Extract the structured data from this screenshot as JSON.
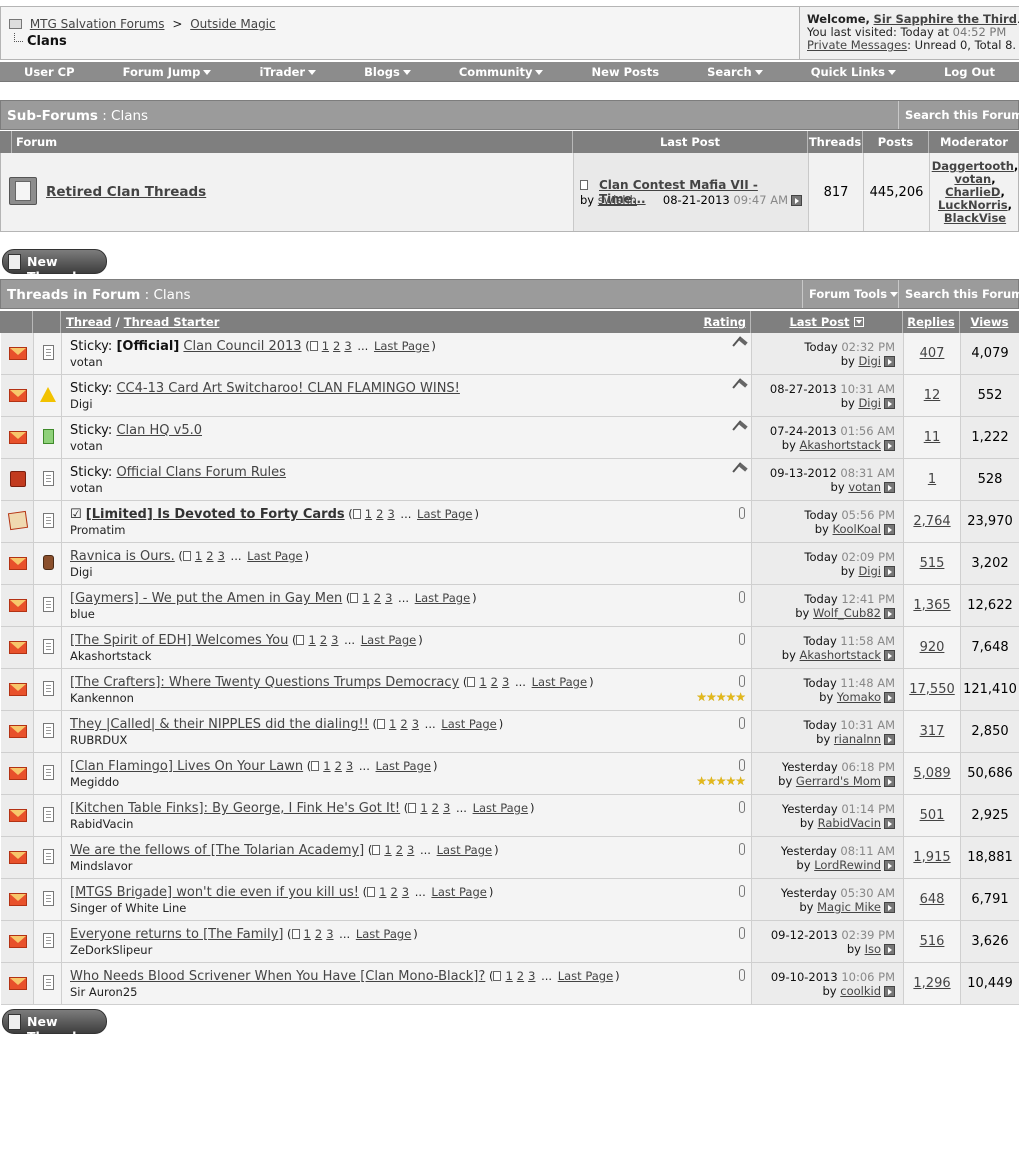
{
  "breadcrumb": {
    "root": "MTG Salvation Forums",
    "separator": ">",
    "parent": "Outside Magic",
    "current": "Clans"
  },
  "welcome": {
    "greeting": "Welcome,",
    "username": "Sir Sapphire the Third",
    "last_visited_label": "You last visited:",
    "last_visited_day": "Today at",
    "last_visited_time": "04:52 PM",
    "pm_link": "Private Messages",
    "pm_status": ": Unread 0, Total 8."
  },
  "navbar": [
    {
      "label": "User CP",
      "dropdown": false
    },
    {
      "label": "Forum Jump",
      "dropdown": true
    },
    {
      "label": "iTrader",
      "dropdown": true
    },
    {
      "label": "Blogs",
      "dropdown": true
    },
    {
      "label": "Community",
      "dropdown": true
    },
    {
      "label": "New Posts",
      "dropdown": false
    },
    {
      "label": "Search",
      "dropdown": true
    },
    {
      "label": "Quick Links",
      "dropdown": true
    },
    {
      "label": "Log Out",
      "dropdown": false
    }
  ],
  "subforums": {
    "header_bold": "Sub-Forums",
    "header_rest": " : Clans",
    "search_tool": "Search this Forum",
    "columns": {
      "forum": "Forum",
      "last_post": "Last Post",
      "threads": "Threads",
      "posts": "Posts",
      "moderator": "Moderator"
    },
    "row": {
      "name": "Retired Clan Threads",
      "last_post_title": "Clan Contest Mafia VII - Time...",
      "by": "by",
      "author": "swishh",
      "date": "08-21-2013",
      "time": "09:47 AM",
      "threads": "817",
      "posts": "445,206",
      "moderators": [
        "Daggertooth",
        "votan",
        "CharlieD",
        "LuckNorris",
        "BlackVise"
      ]
    }
  },
  "new_thread_label": "New Thread",
  "threads_section": {
    "header_bold": "Threads in Forum",
    "header_rest": " : Clans",
    "forum_tools": "Forum Tools",
    "search_tool": "Search this Forum",
    "columns": {
      "thread": "Thread",
      "slash": " / ",
      "starter": "Thread Starter",
      "rating": "Rating",
      "last_post": "Last Post",
      "replies": "Replies",
      "views": "Views"
    }
  },
  "threads": [
    {
      "prefix": "Sticky:",
      "bold": "[Official]",
      "title": "Clan Council 2013",
      "pages": "1 2 3 ... Last Page",
      "starter": "votan",
      "day": "Today",
      "time": "02:32 PM",
      "by": "Digi",
      "replies": "407",
      "views": "4,079",
      "pinned": true,
      "attach": false,
      "stars": ""
    },
    {
      "prefix": "Sticky:",
      "bold": "",
      "title": "CC4-13 Card Art Switcharoo! CLAN FLAMINGO WINS!",
      "pages": "",
      "starter": "Digi",
      "day": "08-27-2013",
      "time": "10:31 AM",
      "by": "Digi",
      "replies": "12",
      "views": "552",
      "pinned": true,
      "attach": false,
      "stars": ""
    },
    {
      "prefix": "Sticky:",
      "bold": "",
      "title": "Clan HQ v5.0",
      "pages": "",
      "starter": "votan",
      "day": "07-24-2013",
      "time": "01:56 AM",
      "by": "Akashortstack",
      "replies": "11",
      "views": "1,222",
      "pinned": true,
      "attach": false,
      "stars": ""
    },
    {
      "prefix": "Sticky:",
      "bold": "",
      "title": "Official Clans Forum Rules",
      "pages": "",
      "starter": "votan",
      "day": "09-13-2012",
      "time": "08:31 AM",
      "by": "votan",
      "replies": "1",
      "views": "528",
      "pinned": true,
      "attach": false,
      "stars": ""
    },
    {
      "prefix": "☑",
      "bold": "",
      "title": "[Limited] Is Devoted to Forty Cards",
      "pages": "1 2 3 ... Last Page",
      "starter": "Promatim",
      "day": "Today",
      "time": "05:56 PM",
      "by": "KoolKoal",
      "replies": "2,764",
      "views": "23,970",
      "pinned": false,
      "attach": true,
      "stars": ""
    },
    {
      "prefix": "",
      "bold": "",
      "title": "Ravnica is Ours.",
      "pages": "1 2 3 ... Last Page",
      "starter": "Digi",
      "day": "Today",
      "time": "02:09 PM",
      "by": "Digi",
      "replies": "515",
      "views": "3,202",
      "pinned": false,
      "attach": false,
      "stars": ""
    },
    {
      "prefix": "",
      "bold": "",
      "title": "[Gaymers] - We put the Amen in Gay Men",
      "pages": "1 2 3 ... Last Page",
      "starter": "blue",
      "day": "Today",
      "time": "12:41 PM",
      "by": "Wolf_Cub82",
      "replies": "1,365",
      "views": "12,622",
      "pinned": false,
      "attach": true,
      "stars": ""
    },
    {
      "prefix": "",
      "bold": "",
      "title": "[The Spirit of EDH] Welcomes You",
      "pages": "1 2 3 ... Last Page",
      "starter": "Akashortstack",
      "day": "Today",
      "time": "11:58 AM",
      "by": "Akashortstack",
      "replies": "920",
      "views": "7,648",
      "pinned": false,
      "attach": true,
      "stars": ""
    },
    {
      "prefix": "",
      "bold": "",
      "title": "[The Crafters]: Where Twenty Questions Trumps Democracy",
      "pages": "1 2 3 ... Last Page",
      "starter": "Kankennon",
      "day": "Today",
      "time": "11:48 AM",
      "by": "Yomako",
      "replies": "17,550",
      "views": "121,410",
      "pinned": false,
      "attach": true,
      "stars": "★★★★★"
    },
    {
      "prefix": "",
      "bold": "",
      "title": "They |Called| & their NIPPLES did the dialing!!",
      "pages": "1 2 3 ... Last Page",
      "starter": "RUBRDUX",
      "day": "Today",
      "time": "10:31 AM",
      "by": "rianalnn",
      "replies": "317",
      "views": "2,850",
      "pinned": false,
      "attach": true,
      "stars": ""
    },
    {
      "prefix": "",
      "bold": "",
      "title": "[Clan Flamingo] Lives On Your Lawn",
      "pages": "1 2 3 ... Last Page",
      "starter": "Megiddo",
      "day": "Yesterday",
      "time": "06:18 PM",
      "by": "Gerrard's Mom",
      "replies": "5,089",
      "views": "50,686",
      "pinned": false,
      "attach": true,
      "stars": "★★★★★"
    },
    {
      "prefix": "",
      "bold": "",
      "title": "[Kitchen Table Finks]: By George, I Fink He's Got It!",
      "pages": "1 2 3 ... Last Page",
      "starter": "RabidVacin",
      "day": "Yesterday",
      "time": "01:14 PM",
      "by": "RabidVacin",
      "replies": "501",
      "views": "2,925",
      "pinned": false,
      "attach": true,
      "stars": ""
    },
    {
      "prefix": "",
      "bold": "",
      "title": "We are the fellows of [The Tolarian Academy]",
      "pages": "1 2 3 ... Last Page",
      "starter": "Mindslavor",
      "day": "Yesterday",
      "time": "08:11 AM",
      "by": "LordRewind",
      "replies": "1,915",
      "views": "18,881",
      "pinned": false,
      "attach": true,
      "stars": ""
    },
    {
      "prefix": "",
      "bold": "",
      "title": "[MTGS Brigade] won't die even if you kill us!",
      "pages": "1 2 3 ... Last Page",
      "starter": "Singer of White Line",
      "day": "Yesterday",
      "time": "05:30 AM",
      "by": "Magic Mike",
      "replies": "648",
      "views": "6,791",
      "pinned": false,
      "attach": true,
      "stars": ""
    },
    {
      "prefix": "",
      "bold": "",
      "title": "Everyone returns to [The Family]",
      "pages": "1 2 3 ... Last Page",
      "starter": "ZeDorkSlipeur",
      "day": "09-12-2013",
      "time": "02:39 PM",
      "by": "Iso",
      "replies": "516",
      "views": "3,626",
      "pinned": false,
      "attach": true,
      "stars": ""
    },
    {
      "prefix": "",
      "bold": "",
      "title": "Who Needs Blood Scrivener When You Have [Clan Mono-Black]?",
      "pages": "1 2 3 ... Last Page",
      "starter": "Sir Auron25",
      "day": "09-10-2013",
      "time": "10:06 PM",
      "by": "coolkid",
      "replies": "1,296",
      "views": "10,449",
      "pinned": false,
      "attach": true,
      "stars": ""
    }
  ]
}
